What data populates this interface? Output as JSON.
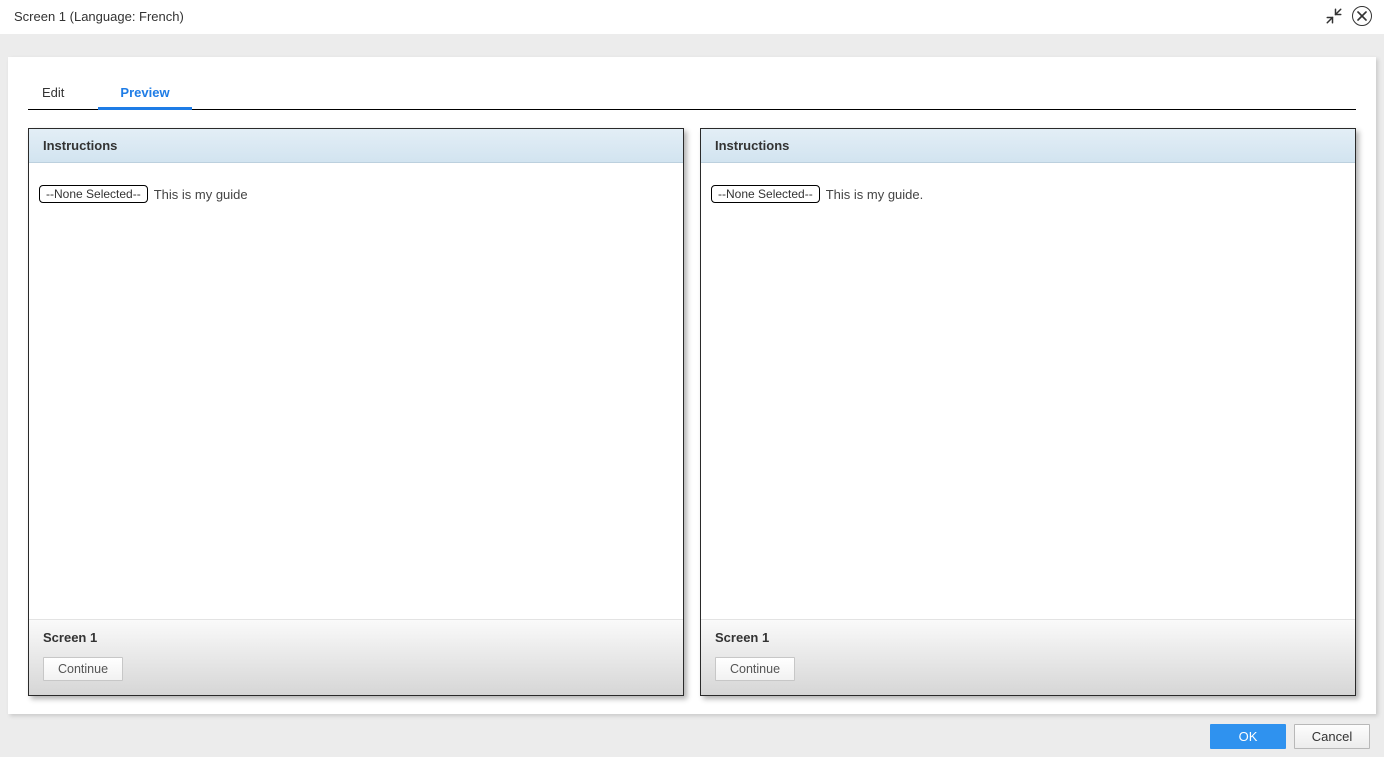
{
  "titlebar": {
    "title": "Screen 1 (Language: French)"
  },
  "tabs": {
    "edit": "Edit",
    "preview": "Preview"
  },
  "panes": {
    "left": {
      "header": "Instructions",
      "pill": "--None Selected--",
      "text": "This is my guide",
      "footer_label": "Screen 1",
      "continue": "Continue"
    },
    "right": {
      "header": "Instructions",
      "pill": "--None Selected--",
      "text": "This is my guide.",
      "footer_label": "Screen 1",
      "continue": "Continue"
    }
  },
  "buttons": {
    "ok": "OK",
    "cancel": "Cancel"
  }
}
